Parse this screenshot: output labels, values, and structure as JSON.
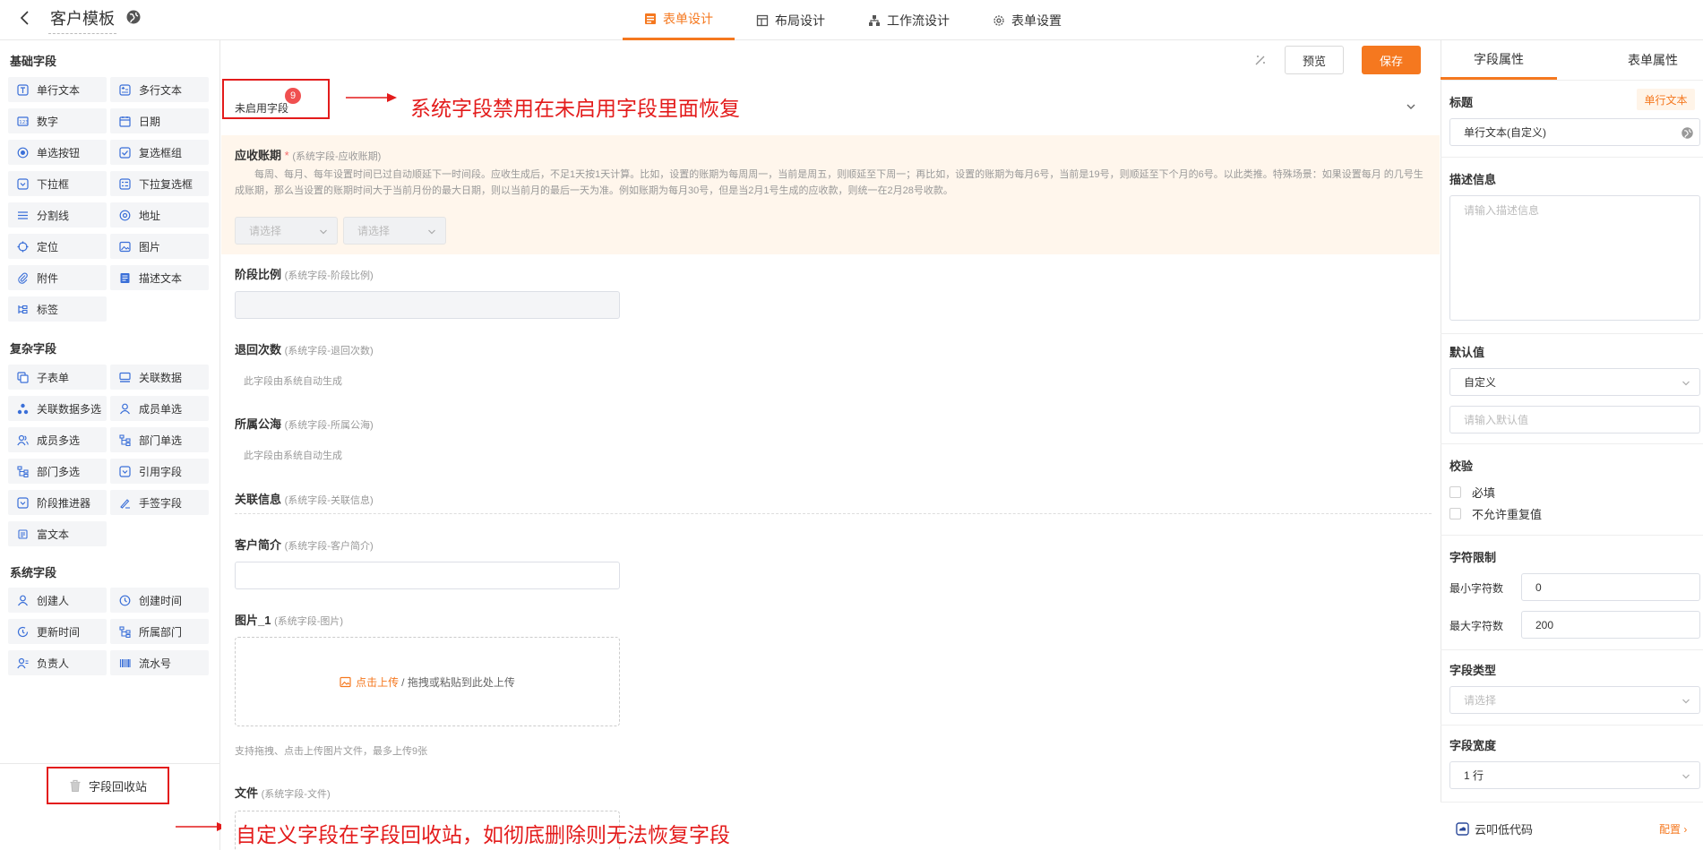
{
  "header": {
    "title": "客户模板",
    "tabs": [
      {
        "label": "表单设计",
        "active": true,
        "icon": "form-icon"
      },
      {
        "label": "布局设计",
        "active": false,
        "icon": "layout-icon"
      },
      {
        "label": "工作流设计",
        "active": false,
        "icon": "workflow-icon"
      },
      {
        "label": "表单设置",
        "active": false,
        "icon": "gear-icon"
      }
    ]
  },
  "palette": {
    "basic_title": "基础字段",
    "basic": [
      "单行文本",
      "多行文本",
      "数字",
      "日期",
      "单选按钮",
      "复选框组",
      "下拉框",
      "下拉复选框",
      "分割线",
      "地址",
      "定位",
      "图片",
      "附件",
      "描述文本",
      "标签"
    ],
    "complex_title": "复杂字段",
    "complex": [
      "子表单",
      "关联数据",
      "关联数据多选",
      "成员单选",
      "成员多选",
      "部门单选",
      "部门多选",
      "引用字段",
      "阶段推进器",
      "手签字段",
      "富文本"
    ],
    "system_title": "系统字段",
    "system": [
      "创建人",
      "创建时间",
      "更新时间",
      "所属部门",
      "负责人",
      "流水号"
    ],
    "recycle": "字段回收站"
  },
  "toolbar": {
    "preview": "预览",
    "save": "保存"
  },
  "canvas": {
    "unused_label": "未启用字段",
    "unused_count": "9",
    "annotation_top": "系统字段禁用在未启用字段里面恢复",
    "annotation_bottom": "自定义字段在字段回收站，如彻底删除则无法恢复字段",
    "fields": {
      "period": {
        "label": "应收账期",
        "required": "*",
        "sub": "(系统字段-应收账期)",
        "desc": "每周、每月、每年设置时间已过自动顺延下一时间段。应收生成后，不足1天按1天计算。比如，设置的账期为每周周一，当前是周五，则顺延至下周一；再比如，设置的账期为每月6号，当前是19号，则顺延至下个月的6号。以此类推。特殊场景：如果设置每月 的几号生成账期，那么当设置的账期时间大于当前月份的最大日期，则以当前月的最后一天为准。例如账期为每月30号，但是当2月1号生成的应收款，则统一在2月28号收款。",
        "select1": "请选择",
        "select2": "请选择"
      },
      "ratio": {
        "label": "阶段比例",
        "sub": "(系统字段-阶段比例)"
      },
      "returns": {
        "label": "退回次数",
        "sub": "(系统字段-退回次数)",
        "auto": "此字段由系统自动生成"
      },
      "sea": {
        "label": "所属公海",
        "sub": "(系统字段-所属公海)",
        "auto": "此字段由系统自动生成"
      },
      "related": {
        "label": "关联信息",
        "sub": "(系统字段-关联信息)"
      },
      "intro": {
        "label": "客户简介",
        "sub": "(系统字段-客户简介)"
      },
      "image": {
        "label": "图片_1",
        "sub": "(系统字段-图片)",
        "upload_link": "点击上传",
        "upload_rest": "/ 拖拽或粘贴到此处上传",
        "tip": "支持拖拽、点击上传图片文件，最多上传9张"
      },
      "file": {
        "label": "文件",
        "sub": "(系统字段-文件)"
      }
    }
  },
  "props": {
    "tab_field": "字段属性",
    "tab_form": "表单属性",
    "title_label": "标题",
    "type_tag": "单行文本",
    "title_value": "单行文本(自定义)",
    "desc_label": "描述信息",
    "desc_placeholder": "请输入描述信息",
    "default_label": "默认值",
    "default_mode": "自定义",
    "default_placeholder": "请输入默认值",
    "validate_label": "校验",
    "required": "必填",
    "no_duplicate": "不允许重复值",
    "limit_label": "字符限制",
    "min_label": "最小字符数",
    "min_value": "0",
    "max_label": "最大字符数",
    "max_value": "200",
    "field_type_label": "字段类型",
    "field_type_placeholder": "请选择",
    "width_label": "字段宽度",
    "width_value": "1 行",
    "brand": "云叩低代码",
    "config": "配置"
  },
  "colors": {
    "accent": "#f5781f",
    "annotation": "#e31b1b"
  }
}
